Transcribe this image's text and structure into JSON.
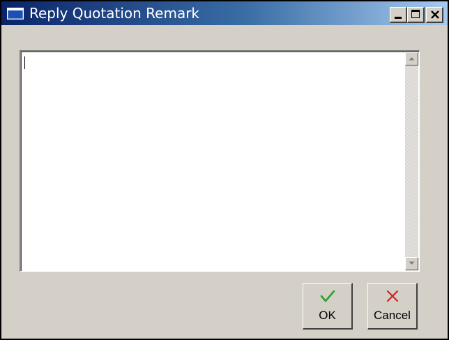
{
  "window": {
    "title": "Reply Quotation Remark",
    "icon": "window-icon",
    "controls": [
      "minimize-icon",
      "maximize-icon",
      "close-icon"
    ]
  },
  "remark": {
    "value": "",
    "placeholder": ""
  },
  "buttons": {
    "ok_label": "OK",
    "ok_icon": "checkmark-icon",
    "ok_icon_color": "#2e9e2e",
    "cancel_label": "Cancel",
    "cancel_icon": "cross-icon",
    "cancel_icon_color": "#d42020"
  },
  "colors": {
    "title_bar_start": "#0a246a",
    "title_bar_end": "#a6caf0",
    "face": "#d4d0c8"
  }
}
